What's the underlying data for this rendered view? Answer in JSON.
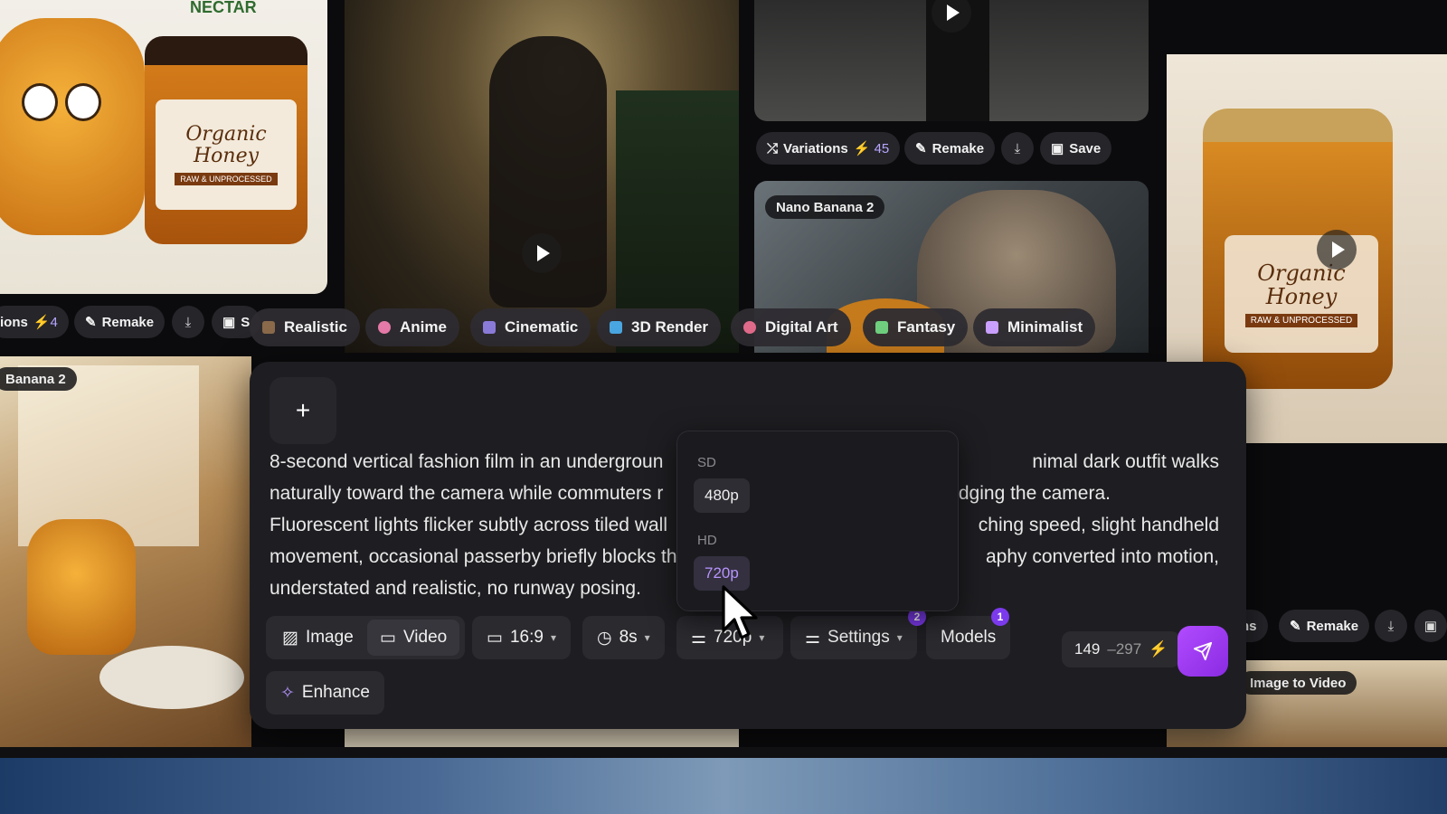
{
  "tiles": {
    "top_left_brand": "NECTAR",
    "jar_text": "Organic Honey",
    "jar_sub": "RAW & UNPROCESSED"
  },
  "top_right_actions": {
    "variations_label": "Variations",
    "variations_count": "45",
    "remake_label": "Remake",
    "save_label": "Save"
  },
  "top_left_actions": {
    "variations_partial": "ions",
    "variations_count": "4",
    "remake_label": "Remake",
    "save_partial": "S"
  },
  "model_tags": {
    "right_tile": "Nano Banana 2",
    "left_tile": "Banana 2",
    "right_bottom_tile": "Image to Video"
  },
  "right_bottom_actions": {
    "variations_partial": "ns",
    "remake_label": "Remake"
  },
  "styles": [
    {
      "label": "Realistic",
      "color": "#8a6a4a"
    },
    {
      "label": "Anime",
      "color": "#e57aa8"
    },
    {
      "label": "Cinematic",
      "color": "#8b7bd8"
    },
    {
      "label": "3D Render",
      "color": "#4aa6e0"
    },
    {
      "label": "Digital Art",
      "color": "#e06a8a"
    },
    {
      "label": "Fantasy",
      "color": "#6fcf7f"
    },
    {
      "label": "Minimalist",
      "color": "#c9a0ff"
    }
  ],
  "composer": {
    "plus_label": "+",
    "prompt_lines": [
      "8-second vertical fashion film in an undergroun",
      "naturally toward the camera while commuters r",
      "Fluorescent lights flicker subtly across tiled wall",
      "movement, occasional passerby briefly blocks th",
      "understated and realistic, no runway posing."
    ],
    "prompt_lines_right": [
      "nimal dark outfit walks",
      "edging the camera.",
      "ching speed, slight handheld",
      "aphy converted into motion,",
      ""
    ],
    "mode_image": "Image",
    "mode_video": "Video",
    "aspect": "16:9",
    "duration": "8s",
    "resolution": "720p",
    "settings_label": "Settings",
    "settings_badge": "2",
    "models_label": "Models",
    "models_badge": "1",
    "enhance_label": "Enhance",
    "cost_value": "149",
    "cost_range": "–297"
  },
  "resolution_dropdown": {
    "group_sd": "SD",
    "opt_480": "480p",
    "group_hd": "HD",
    "opt_720": "720p"
  }
}
